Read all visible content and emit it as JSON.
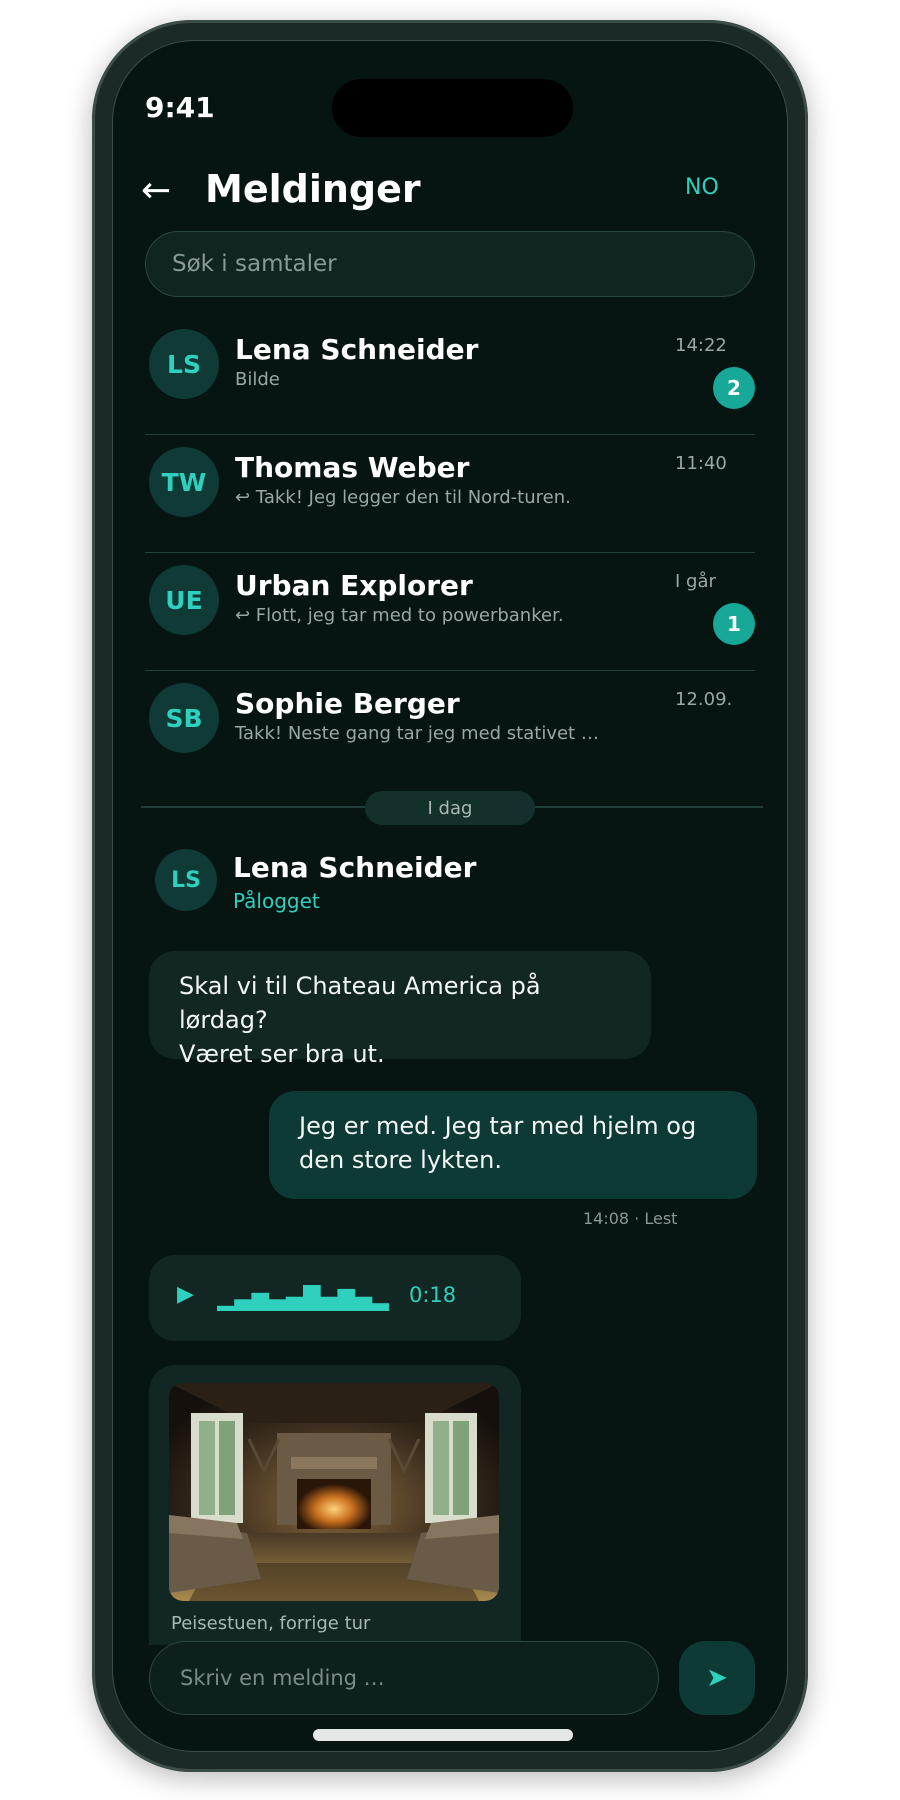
{
  "status_bar": {
    "time": "9:41"
  },
  "header": {
    "back_icon": "←",
    "title": "Meldinger",
    "language": "NO"
  },
  "search": {
    "placeholder": "Søk i samtaler"
  },
  "conversations": [
    {
      "initials": "LS",
      "name": "Lena Schneider",
      "preview": "Bilde",
      "time": "14:22",
      "unread": "2"
    },
    {
      "initials": "TW",
      "name": "Thomas Weber",
      "preview": "↩ Takk! Jeg legger den til Nord-turen.",
      "time": "11:40",
      "unread": ""
    },
    {
      "initials": "UE",
      "name": "Urban Explorer",
      "preview": "↩ Flott, jeg tar med to powerbanker.",
      "time": "I går",
      "unread": "1"
    },
    {
      "initials": "SB",
      "name": "Sophie Berger",
      "preview": "Takk! Neste gang tar jeg med stativet …",
      "time": "12.09.",
      "unread": ""
    }
  ],
  "day_divider": "I dag",
  "chat": {
    "initials": "LS",
    "name": "Lena Schneider",
    "status": "Pålogget",
    "messages": [
      {
        "direction": "in",
        "lines": [
          "Skal vi til Chateau America på lørdag?",
          "Været ser bra ut."
        ]
      },
      {
        "direction": "out",
        "lines": [
          "Jeg er med. Jeg tar med hjelm og",
          "den store lykten."
        ],
        "meta": "14:08 · Lest"
      }
    ],
    "voice": {
      "play_icon": "▶",
      "duration": "0:18",
      "waveform": [
        0.2,
        0.45,
        0.7,
        0.45,
        0.55,
        1.0,
        0.55,
        0.85,
        0.55,
        0.3
      ]
    },
    "photo": {
      "caption": "Peisestuen, forrige tur"
    }
  },
  "composer": {
    "placeholder": "Skriv en melding …",
    "send_icon": "➤"
  },
  "colors": {
    "accent": "#2fd0bd",
    "badge": "#17a898",
    "background": "#061412"
  }
}
